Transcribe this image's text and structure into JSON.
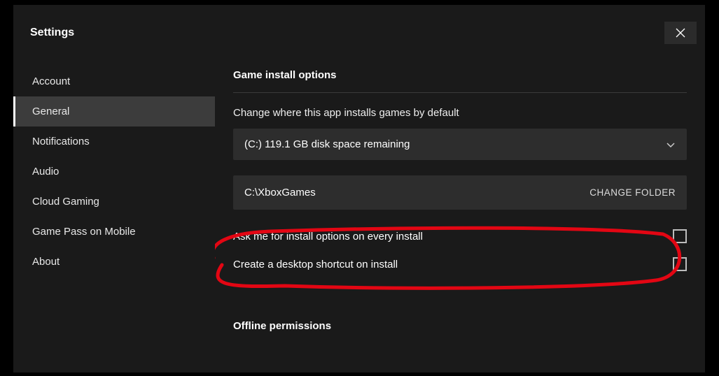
{
  "header": {
    "title": "Settings"
  },
  "sidebar": {
    "items": [
      {
        "label": "Account"
      },
      {
        "label": "General"
      },
      {
        "label": "Notifications"
      },
      {
        "label": "Audio"
      },
      {
        "label": "Cloud Gaming"
      },
      {
        "label": "Game Pass on Mobile"
      },
      {
        "label": "About"
      }
    ],
    "active_index": 1
  },
  "main": {
    "section_title": "Game install options",
    "change_where_label": "Change where this app installs games by default",
    "drive_selected": "(C:) 119.1 GB disk space remaining",
    "install_folder_path": "C:\\XboxGames",
    "change_folder_button": "CHANGE FOLDER",
    "ask_install_options_label": "Ask me for install options on every install",
    "ask_install_options_checked": false,
    "create_shortcut_label": "Create a desktop shortcut on install",
    "create_shortcut_checked": false,
    "offline_section_title": "Offline permissions"
  }
}
